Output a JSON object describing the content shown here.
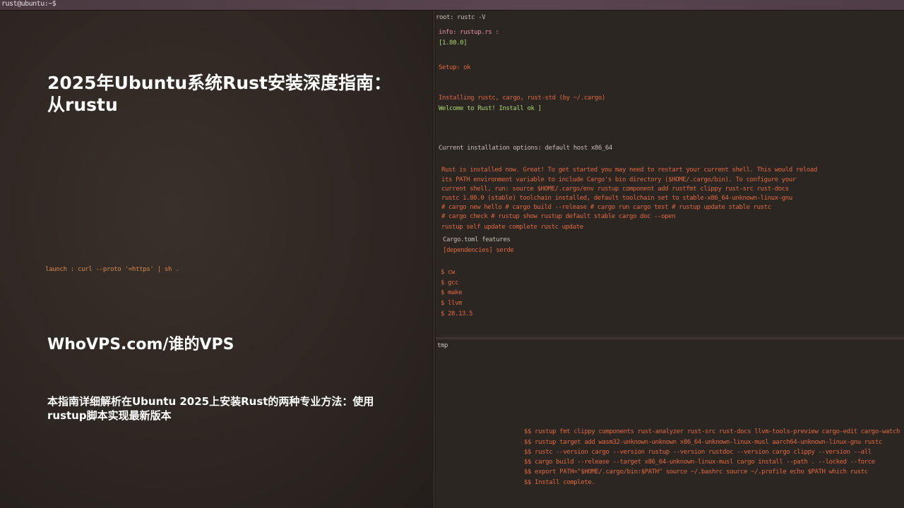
{
  "window": {
    "title": "rust@ubuntu:~$"
  },
  "article": {
    "title": "2025年Ubuntu系统Rust安装深度指南：从rustu",
    "site": "WhoVPS.com/谁的VPS",
    "description": "本指南详细解析在Ubuntu 2025上安装Rust的两种专业方法：使用rustup脚本实现最新版本"
  },
  "left_terminal": {
    "prompt_line": "launch :  curl --proto '=https' | sh ."
  },
  "terminal": {
    "header": "root: rustc -V",
    "line1": "info: rustup.rs :",
    "line2": "[1.80.0]",
    "line3": "Setup: ok",
    "line4": "Installing rustc, cargo, rust-std  (by ~/.cargo)",
    "line5": "Welcome to Rust! Install ok ]",
    "line6": "Current installation options: default host x86_64",
    "block": [
      "Rust is installed now. Great! To get started you may need to restart your current shell. This would reload",
      "its PATH environment variable to include Cargo's bin directory ($HOME/.cargo/bin). To configure your",
      "current shell, run: source $HOME/.cargo/env  rustup component add rustfmt clippy rust-src rust-docs",
      "rustc 1.80.0 (stable) toolchain installed, default toolchain set to stable-x86_64-unknown-linux-gnu",
      "# cargo new hello  # cargo build --release  # cargo run  cargo test  # rustup update stable  rustc",
      "# cargo check  # rustup show  rustup default stable  cargo doc --open",
      "rustup self update complete  rustc update"
    ],
    "section": "Cargo.toml features",
    "section_sub": "[dependencies] serde",
    "list": [
      "$ cw",
      "$ gcc",
      "$ make",
      "$ llvm",
      "$ 28.13.5"
    ],
    "lower_header": "tmp",
    "lower_lines": [
      "$$  rustup  fmt clippy components rust-analyzer rust-src rust-docs llvm-tools-preview cargo-edit cargo-watch",
      "$$  rustup target add wasm32-unknown-unknown x86_64-unknown-linux-musl aarch64-unknown-linux-gnu rustc",
      "$$  rustc  --version  cargo --version  rustup --version  rustdoc --version  cargo clippy --version --all",
      "$$  cargo  build --release --target x86_64-unknown-linux-musl  cargo install --path . --locked --force",
      "$$  export PATH=\"$HOME/.cargo/bin:$PATH\"  source ~/.bashrc  source ~/.profile  echo $PATH  which rustc",
      "$$  Install complete."
    ]
  }
}
